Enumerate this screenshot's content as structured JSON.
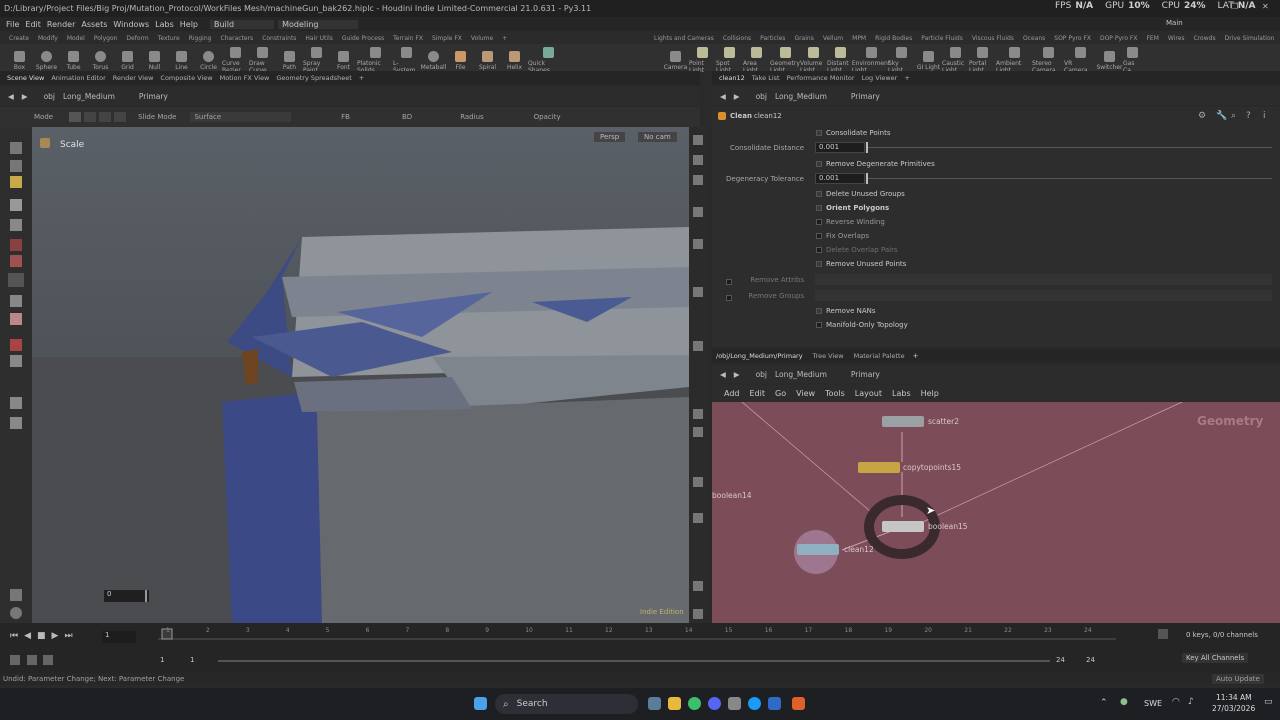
{
  "window": {
    "title": "D:/Library/Project Files/Big Proj/Mutation_Protocol/WorkFiles Mesh/machineGun_bak262.hiplc - Houdini Indie Limited-Commercial 21.0.631 - Py3.11",
    "fps_label": "FPS",
    "fps_value": "N/A",
    "gpu_label": "GPU",
    "gpu_value": "10%",
    "cpu_label": "CPU",
    "cpu_value": "24%",
    "lat_label": "LAT",
    "lat_value": "N/A",
    "layout_name": "Main"
  },
  "menu": [
    "File",
    "Edit",
    "Render",
    "Assets",
    "Windows",
    "Labs",
    "Help"
  ],
  "desktops": {
    "build": "Build",
    "modeling": "Modeling"
  },
  "shelf_tabs_left": [
    "Create",
    "Modify",
    "Model",
    "Polygon",
    "Deform",
    "Texture",
    "Rigging",
    "Characters",
    "Constraints",
    "Hair Utils",
    "Guide Process",
    "Terrain FX",
    "Simple FX",
    "Volume"
  ],
  "shelf_tabs_right": [
    "Lights and Cameras",
    "Collisions",
    "Particles",
    "Grains",
    "Vellum",
    "MPM",
    "Rigid Bodies",
    "Particle Fluids",
    "Viscous Fluids",
    "Oceans",
    "SOP Pyro FX",
    "DOP Pyro FX",
    "FEM",
    "Wires",
    "Crowds",
    "Drive Simulation"
  ],
  "shelf_tools_left": [
    "Box",
    "Sphere",
    "Tube",
    "Torus",
    "Grid",
    "Null",
    "Line",
    "Circle",
    "Curve Bezier",
    "Draw Curve",
    "Path",
    "Spray Paint",
    "Font",
    "Platonic Solids",
    "L-System",
    "Metaball",
    "File",
    "Spiral",
    "Helix",
    "Quick Shapes"
  ],
  "shelf_tools_right": [
    "Camera",
    "Point Light",
    "Spot Light",
    "Area Light",
    "Geometry Light",
    "Volume Light",
    "Distant Light",
    "Environment Light",
    "Sky Light",
    "GI Light",
    "Caustic Light",
    "Portal Light",
    "Ambient Light",
    "Stereo Camera",
    "VR Camera",
    "Switcher",
    "Gas Ca"
  ],
  "left_pane_tabs": [
    "Scene View",
    "Animation Editor",
    "Render View",
    "Composite View",
    "Motion FX View",
    "Geometry Spreadsheet"
  ],
  "right_pane_tabs": [
    "clean12",
    "Take List",
    "Performance Monitor",
    "Log Viewer"
  ],
  "path_left": {
    "root": "obj",
    "geo": "Long_Medium",
    "sub": "Primary"
  },
  "viewport": {
    "mode_label": "Mode",
    "slide_mode": "Slide Mode",
    "surface": "Surface",
    "fb": "FB",
    "bd": "BD",
    "radius": "Radius",
    "opacity": "Opacity",
    "tool_name": "Scale",
    "persp": "Persp",
    "cam": "No cam",
    "edition": "Indie Edition",
    "slider_value": "0"
  },
  "params": {
    "node_type": "Clean",
    "node_name": "clean12",
    "consolidate_points": "Consolidate Points",
    "consolidate_distance_label": "Consolidate Distance",
    "consolidate_distance": "0.001",
    "remove_degenerate": "Remove Degenerate Primitives",
    "degeneracy_label": "Degeneracy Tolerance",
    "degeneracy": "0.001",
    "delete_unused_groups": "Delete Unused Groups",
    "orient_polygons": "Orient Polygons",
    "reverse_winding": "Reverse Winding",
    "fix_overlaps": "Fix Overlaps",
    "delete_overlap_pairs": "Delete Overlap Pairs",
    "remove_unused_points": "Remove Unused Points",
    "remove_attribs": "Remove Attribs",
    "remove_groups": "Remove Groups",
    "remove_nans": "Remove NANs",
    "manifold_only": "Manifold-Only Topology"
  },
  "network": {
    "tabs": [
      "/obj/Long_Medium/Primary",
      "Tree View",
      "Material Palette"
    ],
    "menu": [
      "Add",
      "Edit",
      "Go",
      "View",
      "Tools",
      "Layout",
      "Labs",
      "Help"
    ],
    "context": "Geometry",
    "nodes": {
      "scatter": "scatter2",
      "copy": "copytopoints15",
      "bool14": "boolean14",
      "bool15": "boolean15",
      "clean": "clean12"
    }
  },
  "timeline": {
    "frame": "1",
    "start": "1",
    "end_a": "1",
    "end_b": "24",
    "end_c": "24",
    "ticks": [
      "1",
      "2",
      "3",
      "4",
      "5",
      "6",
      "7",
      "8",
      "9",
      "10",
      "11",
      "12",
      "13",
      "14",
      "15",
      "16",
      "17",
      "18",
      "19",
      "20",
      "21",
      "22",
      "23",
      "24"
    ],
    "keys": "0 keys, 0/0 channels",
    "key_all": "Key All Channels",
    "auto_update": "Auto Update"
  },
  "status": "Undid: Parameter Change; Next: Parameter Change",
  "taskbar": {
    "search": "Search",
    "lang": "SWE",
    "time": "11:34 AM",
    "date": "27/03/2026"
  }
}
